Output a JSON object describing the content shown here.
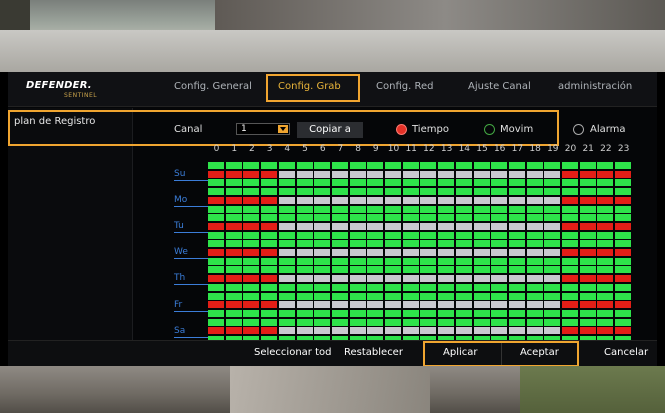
{
  "header": {
    "logo_main": "DEFENDER.",
    "logo_sub": "SENTINEL",
    "tabs": [
      {
        "label": "Config. General",
        "active": false
      },
      {
        "label": "Config. Grab",
        "active": true
      },
      {
        "label": "Config. Red",
        "active": false
      },
      {
        "label": "Ajuste Canal",
        "active": false
      },
      {
        "label": "administración",
        "active": false
      }
    ]
  },
  "sidebar": {
    "items": [
      {
        "label": "plan de Registro"
      }
    ]
  },
  "controls": {
    "canal_label": "Canal",
    "canal_value": "1",
    "copy_button": "Copiar a",
    "modes": [
      {
        "label": "Tiempo",
        "selected": true
      },
      {
        "label": "Movim",
        "selected": false
      },
      {
        "label": "Alarma",
        "selected": false
      }
    ]
  },
  "schedule": {
    "hours": [
      "0",
      "1",
      "2",
      "3",
      "4",
      "5",
      "6",
      "7",
      "8",
      "9",
      "10",
      "11",
      "12",
      "13",
      "14",
      "15",
      "16",
      "17",
      "18",
      "19",
      "20",
      "21",
      "22",
      "23"
    ],
    "days": [
      "Su",
      "Mo",
      "Tu",
      "We",
      "Th",
      "Fr",
      "Sa"
    ],
    "colors": {
      "tiempo": "#e41e17",
      "movim": "#2ee34a",
      "empty": "#c9c9cf",
      "accent": "#f0a530"
    },
    "day_rows": {
      "red_hours": [
        0,
        1,
        2,
        3,
        20,
        21,
        22,
        23
      ],
      "green_all": true
    }
  },
  "footer": {
    "buttons": [
      "Seleccionar tod",
      "Restablecer",
      "Aplicar",
      "Aceptar",
      "Cancelar"
    ]
  }
}
